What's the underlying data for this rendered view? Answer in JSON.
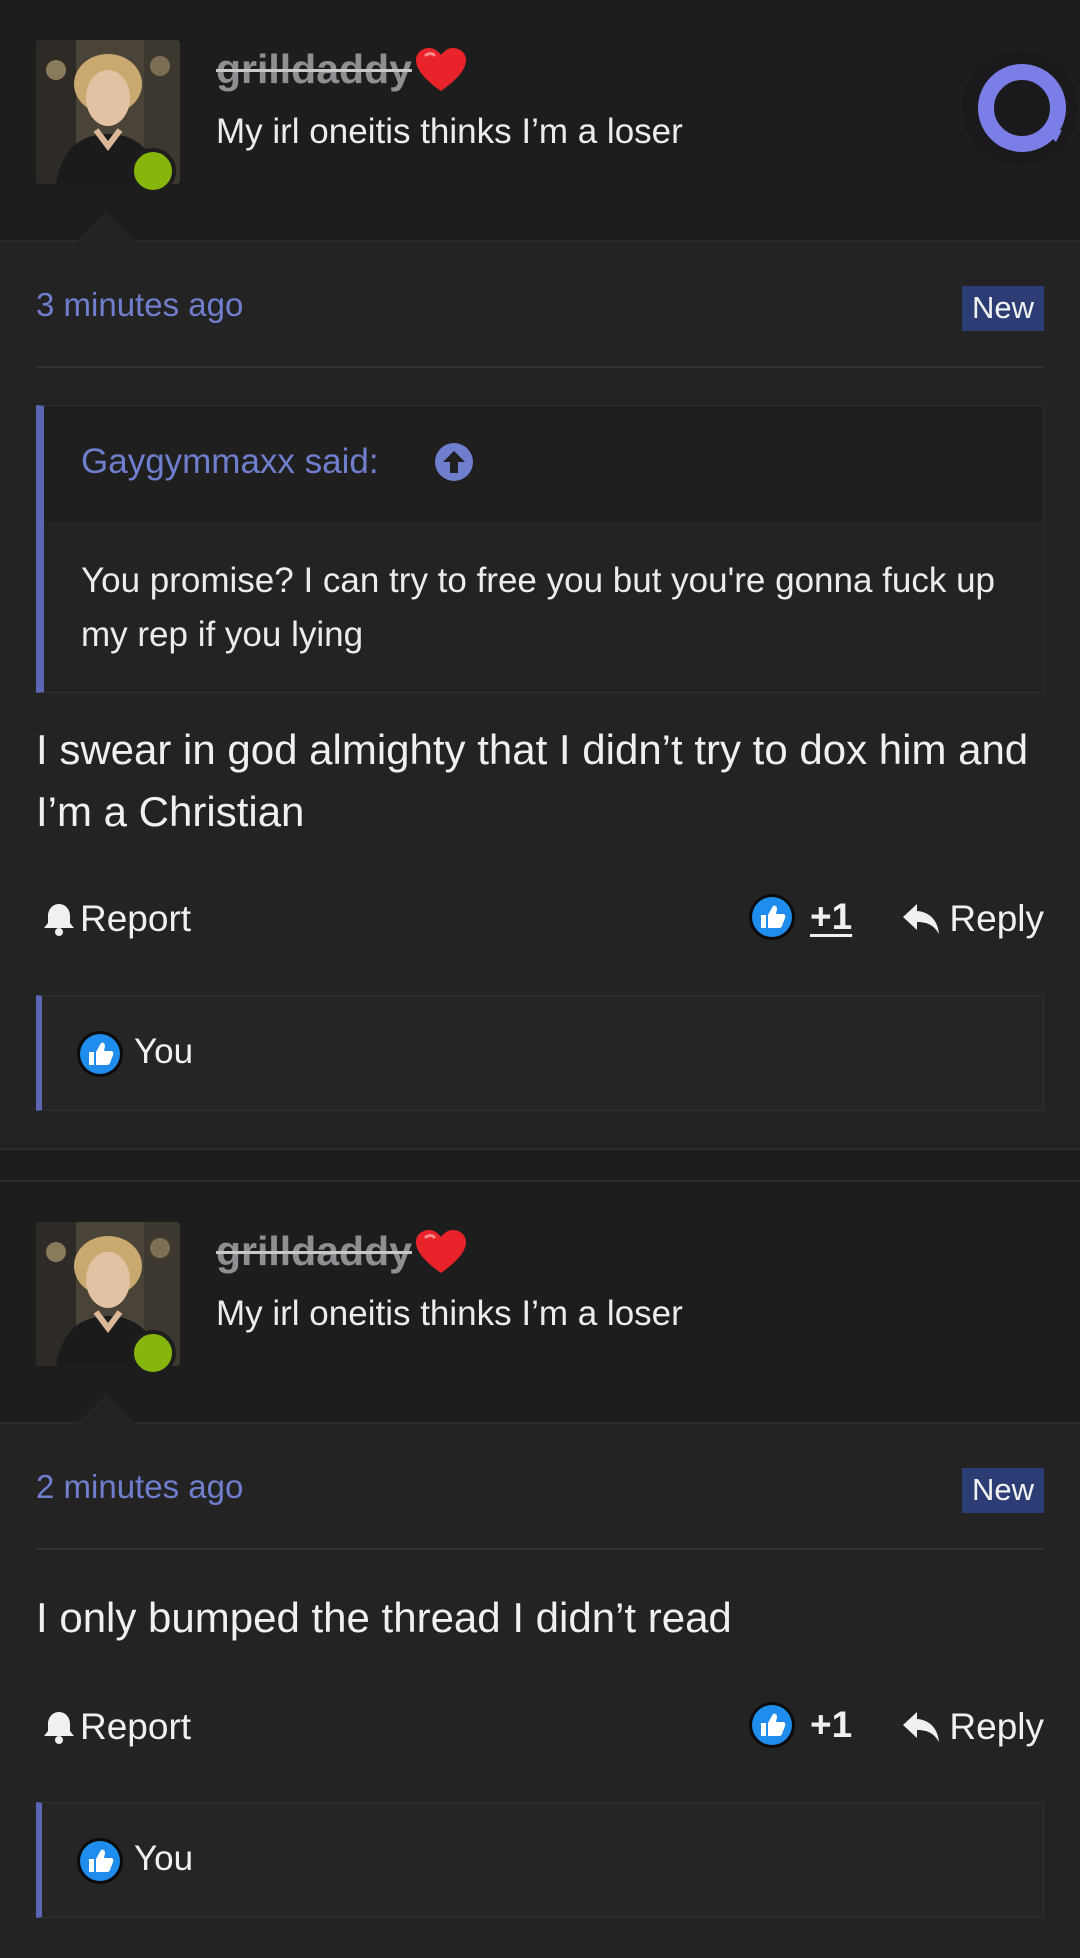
{
  "posts": [
    {
      "username": "grilldaddy",
      "user_title": "My irl oneitis thinks I’m a loser",
      "timestamp": "3 minutes ago",
      "badge": "New",
      "quote": {
        "author": "Gaygymmaxx said:",
        "text": "You promise? I can try to free you but you're gonna fuck up my rep if you lying"
      },
      "text": "I swear in god almighty that I didn’t try to dox him and I’m a Christian",
      "report_label": "Report",
      "like_count": "+1",
      "reply_label": "Reply",
      "reactor": "You"
    },
    {
      "username": "grilldaddy",
      "user_title": "My irl oneitis thinks I’m a loser",
      "timestamp": "2 minutes ago",
      "badge": "New",
      "text": "I only bumped the thread I didn’t read",
      "report_label": "Report",
      "like_count": "+1",
      "reply_label": "Reply",
      "reactor": "You"
    }
  ],
  "colors": {
    "accent": "#5b66b5",
    "link": "#6f7fce",
    "online": "#86b50b",
    "badge_bg": "#2c3d75",
    "like_blue": "#1f8ded"
  },
  "icons": [
    "heart-icon",
    "scroll-up-arrow-icon",
    "bell-icon",
    "thumbs-up-icon",
    "reply-arrow-icon",
    "site-logo-icon"
  ]
}
